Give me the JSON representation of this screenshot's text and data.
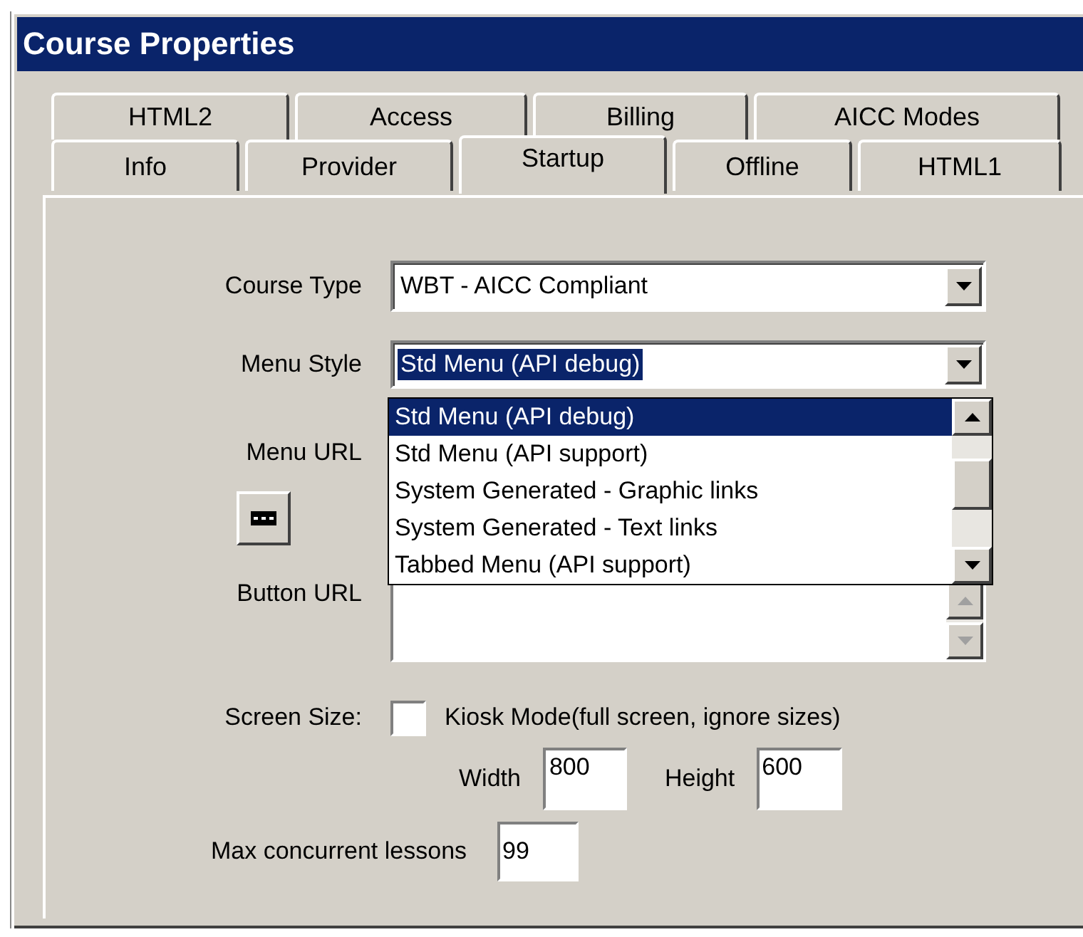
{
  "window": {
    "title": "Course Properties"
  },
  "tab_rows": [
    {
      "tabs": [
        {
          "label": "HTML2",
          "selected": false
        },
        {
          "label": "Access",
          "selected": false
        },
        {
          "label": "Billing",
          "selected": false
        },
        {
          "label": "AICC Modes",
          "selected": false
        }
      ]
    },
    {
      "tabs": [
        {
          "label": "Info",
          "selected": false
        },
        {
          "label": "Provider",
          "selected": false
        },
        {
          "label": "Startup",
          "selected": true
        },
        {
          "label": "Offline",
          "selected": false
        },
        {
          "label": "HTML1",
          "selected": false
        }
      ]
    }
  ],
  "course_type": {
    "label": "Course Type",
    "value": "WBT - AICC Compliant"
  },
  "menu_style": {
    "label": "Menu Style",
    "value": "Std Menu (API debug)",
    "focused": true,
    "expanded": true,
    "options": [
      {
        "label": "Std Menu (API debug)",
        "selected": true
      },
      {
        "label": "Std Menu (API support)",
        "selected": false
      },
      {
        "label": "System Generated - Graphic links",
        "selected": false
      },
      {
        "label": "System Generated - Text links",
        "selected": false
      },
      {
        "label": "Tabbed Menu (API support)",
        "selected": false
      }
    ]
  },
  "menu_url": {
    "label": "Menu URL"
  },
  "button_url": {
    "label": "Button URL"
  },
  "screen_size": {
    "label": "Screen Size:",
    "kiosk": {
      "label": "Kiosk Mode(full screen, ignore sizes)",
      "checked": false
    }
  },
  "width": {
    "label": "Width",
    "value": "800"
  },
  "height": {
    "label": "Height",
    "value": "600"
  },
  "max_lessons": {
    "label": "Max concurrent lessons",
    "value": "99"
  }
}
